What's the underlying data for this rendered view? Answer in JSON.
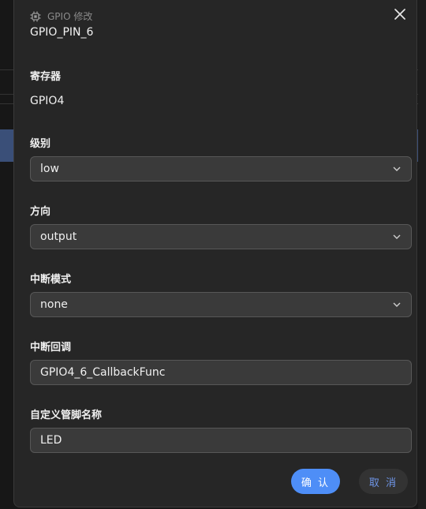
{
  "dialog": {
    "header": "GPIO 修改",
    "title": "GPIO_PIN_6",
    "close_icon": "close-icon"
  },
  "fields": {
    "register": {
      "label": "寄存器",
      "value": "GPIO4"
    },
    "level": {
      "label": "级别",
      "value": "low"
    },
    "direction": {
      "label": "方向",
      "value": "output"
    },
    "interrupt_mode": {
      "label": "中断模式",
      "value": "none"
    },
    "interrupt_callback": {
      "label": "中断回调",
      "value": "GPIO4_6_CallbackFunc"
    },
    "custom_pin_name": {
      "label": "自定义管脚名称",
      "value": "LED"
    }
  },
  "buttons": {
    "confirm": "确 认",
    "cancel": "取 消"
  },
  "colors": {
    "accent": "#4e8ef7",
    "dialog_bg": "#262626",
    "input_bg": "#3a3a3a"
  }
}
